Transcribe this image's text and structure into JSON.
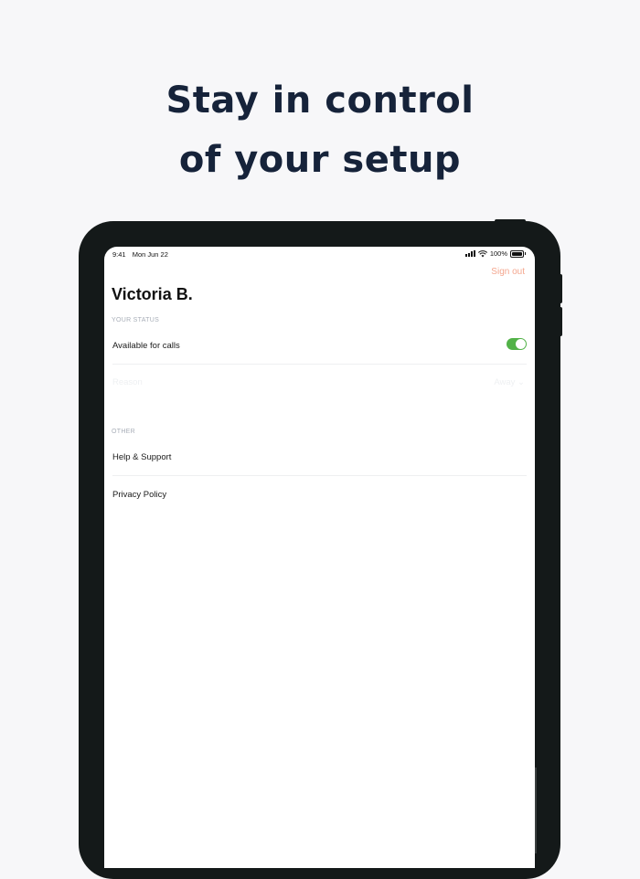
{
  "promo": {
    "headline_line1": "Stay in control",
    "headline_line2": "of your setup"
  },
  "status_bar": {
    "time": "9:41",
    "date": "Mon Jun 22",
    "battery": "100%"
  },
  "header": {
    "sign_out_label": "Sign out",
    "user_name": "Victoria B."
  },
  "status_section": {
    "label": "YOUR STATUS",
    "available_label": "Available for calls",
    "available_on": true,
    "reason_label": "Reason",
    "reason_value": "Away"
  },
  "other_section": {
    "label": "OTHER",
    "items": [
      "Help & Support",
      "Privacy Policy"
    ]
  },
  "colors": {
    "accent": "#f4a78f",
    "toggle_on": "#52b248",
    "headline": "#16233a"
  }
}
